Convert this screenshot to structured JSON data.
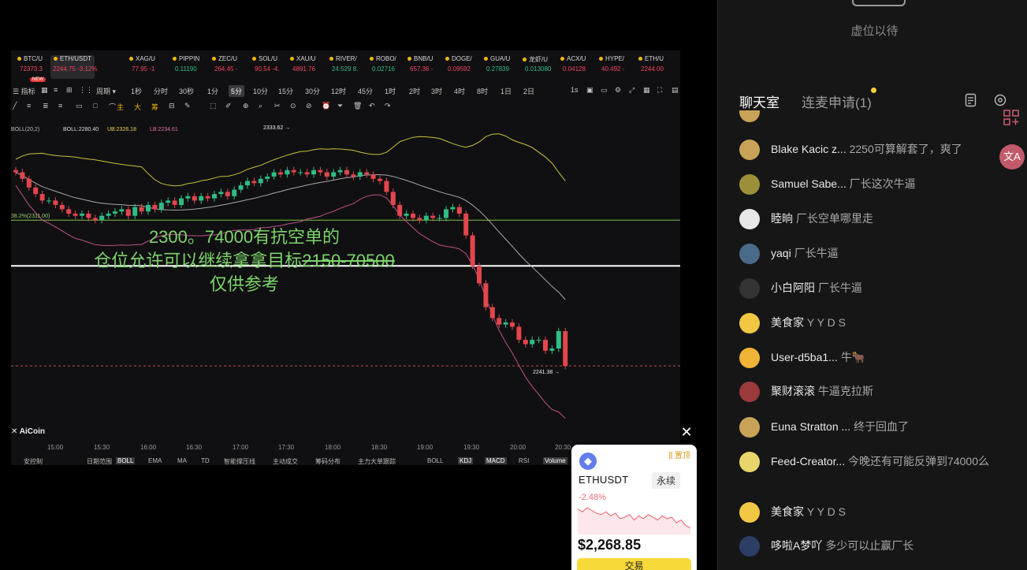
{
  "video": {
    "tickers": [
      {
        "name": "BTC/U",
        "value": "72373.3",
        "dir": "down"
      },
      {
        "name": "ETH/USDT",
        "value": "2244.75 -3.12%",
        "dir": "down",
        "active": true
      },
      {
        "name": "XAG/U",
        "value": "77.95 -1",
        "dir": "down"
      },
      {
        "name": "PIPPIN",
        "value": "0.11190",
        "dir": "up"
      },
      {
        "name": "ZEC/U",
        "value": "264.45 -",
        "dir": "down"
      },
      {
        "name": "SOL/U",
        "value": "90.54 -4.",
        "dir": "down"
      },
      {
        "name": "XAU/U",
        "value": "4891.76",
        "dir": "down"
      },
      {
        "name": "RIVER/",
        "value": "24.529 8.",
        "dir": "up"
      },
      {
        "name": "ROBO/",
        "value": "0.02716",
        "dir": "up"
      },
      {
        "name": "BNB/U",
        "value": "657.36 -",
        "dir": "down"
      },
      {
        "name": "DOGE/",
        "value": "0.09592",
        "dir": "down"
      },
      {
        "name": "GUA/U",
        "value": "0.27839",
        "dir": "up"
      },
      {
        "name": "龙虾/U",
        "value": "0.013080",
        "dir": "up"
      },
      {
        "name": "ACX/U",
        "value": "0.04128",
        "dir": "down"
      },
      {
        "name": "HYPE/",
        "value": "40.492 -",
        "dir": "down"
      },
      {
        "name": "ETH/U",
        "value": "2244.00",
        "dir": "down"
      }
    ],
    "toolbar": {
      "indicators_label": "指标",
      "new_badge": "NEW",
      "period_label": "周期",
      "timeframes": [
        "1秒",
        "分时",
        "30秒",
        "1分",
        "5分",
        "10分",
        "15分",
        "30分",
        "12时",
        "45分",
        "1时",
        "2时",
        "3时",
        "4时",
        "8时",
        "1日",
        "2日"
      ],
      "active_timeframe": "5分",
      "scale_label": "1s"
    },
    "drawbar": {
      "main": "主",
      "large": "大",
      "chip": "筹"
    },
    "legend": {
      "boll": "BOLL(20,2)",
      "boll_val": "BOLL:2280.40",
      "ub": "UB:2326.18",
      "lb": "LB:2234.61",
      "fib": "38.2%(2311.00)"
    },
    "price_marks": {
      "high": "2333.62",
      "low": "2241.38"
    },
    "overlay": {
      "line1": "2300。74000有抗空单的",
      "line2_prefix": "仓位允许可以继续拿拿目标",
      "line2_strike": "2150-70500",
      "line3": "仅供参考"
    },
    "logo": "AiCoin",
    "times": [
      "15:00",
      "15:30",
      "16:00",
      "16:30",
      "17:00",
      "17:30",
      "18:00",
      "18:30",
      "19:00",
      "19:30",
      "20:00",
      "20:30"
    ],
    "indicator_row": [
      "安控制",
      "日期范围",
      "BOLL",
      "EMA",
      "MA",
      "TD",
      "智能撑压线",
      "主动成交",
      "筹码分布",
      "主力大单跟踪",
      "BOLL",
      "KDJ",
      "MACD",
      "RSI",
      "Volume"
    ],
    "active_indicators": [
      "BOLL",
      "KDJ",
      "MACD",
      "Volume"
    ]
  },
  "chart_data": {
    "type": "candlestick",
    "title": "",
    "symbol": "ETH/USDT",
    "interval": "5分",
    "ylim": [
      2210,
      2360
    ],
    "x_ticks": [
      "15:00",
      "15:30",
      "16:00",
      "16:30",
      "17:00",
      "17:30",
      "18:00",
      "18:30",
      "19:00",
      "19:30",
      "20:00",
      "20:30"
    ],
    "horizontal_lines": [
      2311.0,
      2290.0,
      2244.0
    ],
    "close_series": [
      2333,
      2330,
      2326,
      2323,
      2320,
      2320,
      2318,
      2316,
      2314,
      2313,
      2314,
      2312,
      2311,
      2313,
      2314,
      2315,
      2316,
      2313,
      2317,
      2315,
      2318,
      2316,
      2319,
      2320,
      2318,
      2321,
      2322,
      2320,
      2322,
      2321,
      2323,
      2324,
      2322,
      2325,
      2327,
      2329,
      2328,
      2330,
      2331,
      2333,
      2332,
      2334,
      2333,
      2333,
      2332,
      2334,
      2333,
      2331,
      2333,
      2334,
      2332,
      2331,
      2333,
      2332,
      2330,
      2329,
      2324,
      2318,
      2313,
      2314,
      2312,
      2311,
      2313,
      2312,
      2312,
      2316,
      2317,
      2314,
      2304,
      2290,
      2282,
      2271,
      2266,
      2263,
      2264,
      2262,
      2256,
      2254,
      2256,
      2256,
      2251,
      2252,
      2260,
      2244
    ],
    "boll_upper_end": 2330,
    "boll_mid_end": 2282,
    "boll_lower_end": 2236
  },
  "eth_card": {
    "pin_label": "置顶",
    "symbol": "ETHUSDT",
    "perp_tag": "永续",
    "change": "-2.48%",
    "price": "$2,268.85",
    "trade_label": "交易",
    "spark": [
      62,
      60,
      63,
      61,
      59,
      58,
      60,
      57,
      59,
      55,
      56,
      58,
      54,
      57,
      55,
      58,
      56,
      54,
      57,
      55,
      56,
      52,
      54,
      50,
      48
    ]
  },
  "panel": {
    "seat_label": "虚位以待",
    "tab_chat": "聊天室",
    "tab_mic": "连麦申请(1)",
    "translate_label": "文A",
    "messages": [
      {
        "name": "Blake Kacic z...",
        "text": "2250可算解套了，爽了",
        "avatar_color": "#c8a257"
      },
      {
        "name": "Samuel Sabe...",
        "text": "厂长这次牛逼",
        "avatar_color": "#9c8f3a"
      },
      {
        "name": "睦晌",
        "text": "厂长空单哪里走",
        "avatar_color": "#e8e8e8"
      },
      {
        "name": "yaqi",
        "text": "厂长牛逼",
        "avatar_color": "#4a6a8a"
      },
      {
        "name": "小白阿阳",
        "text": "厂长牛逼",
        "avatar_color": "#333333"
      },
      {
        "name": "美食家",
        "text": "Y Y D S",
        "avatar_color": "#f2c744"
      },
      {
        "name": "User-d5ba1...",
        "text": "牛🐂",
        "avatar_color": "#f0b436"
      },
      {
        "name": "聚财滚滚",
        "text": "牛逼克拉斯",
        "avatar_color": "#9a3a3a"
      },
      {
        "name": "Euna Stratton ...",
        "text": "终于回血了",
        "avatar_color": "#c8a257"
      },
      {
        "name": "Feed-Creator...",
        "text": "今晚还有可能反弹到74000么",
        "avatar_color": "#e9d66b"
      },
      {
        "name": "美食家",
        "text": "Y Y D S",
        "avatar_color": "#f2c744"
      },
      {
        "name": "哆啦A梦吖",
        "text": "多少可以止赢厂长",
        "avatar_color": "#2c3e66"
      }
    ]
  }
}
